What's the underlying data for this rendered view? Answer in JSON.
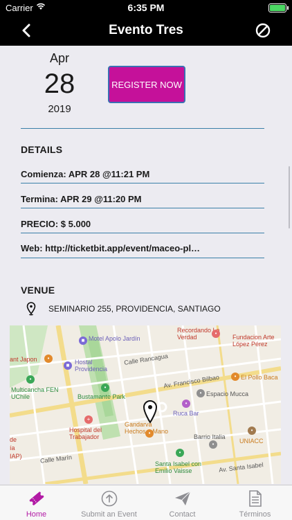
{
  "status_bar": {
    "carrier": "Carrier",
    "time": "6:35 PM"
  },
  "nav": {
    "title": "Evento Tres",
    "back_icon": "chevron-left-icon",
    "action_icon": "block-icon"
  },
  "event_date": {
    "month": "Apr",
    "day": "28",
    "year": "2019"
  },
  "register_label": "REGISTER NOW",
  "details": {
    "title": "DETAILS",
    "start": "Comienza: APR 28 @11:21 PM",
    "end": "Termina: APR 29 @11:20 PM",
    "price": "PRECIO: $ 5.000",
    "web": "Web: http://ticketbit.app/event/maceo-pl…"
  },
  "venue": {
    "title": "VENUE",
    "address": "SEMINARIO 255, PROVIDENCIA, SANTIAGO"
  },
  "map": {
    "labels": {
      "motel_apolo": "Motel Apolo Jardín",
      "hostal": "Hostal Providencia",
      "recordando": "Recordando La Verdad",
      "fundacion": "Fundacion Arte López Pérez",
      "japon": "ant Japon",
      "multicancha": "Multicancha FEN UChile",
      "calle_rancagua": "Calle Rancagua",
      "bustamante": "Bustamante Park",
      "bilbao": "Av. Francisco Bilbao",
      "pollo": "El Pollo Baca",
      "mucca": "Espacio Mucca",
      "ruca": "Ruca Bar",
      "hospital": "Hospital del Trabajador",
      "gandarva": "Gandarva Hechos a Mano",
      "barrio": "Barrio Italia",
      "uniacc": "UNIACC",
      "marin": "Calle Marín",
      "santa_isabel_av": "Av. Santa Isabel",
      "santa_isabel_con": "Santa Isabel con Emilio Vaisse",
      "edge_de": "de",
      "edge_ia": "ía",
      "edge_iap": "IAP)"
    }
  },
  "tabs": [
    {
      "label": "Home",
      "icon": "ticket-icon",
      "active": true
    },
    {
      "label": "Submit an Event",
      "icon": "upload-icon",
      "active": false
    },
    {
      "label": "Contact",
      "icon": "paper-plane-icon",
      "active": false
    },
    {
      "label": "Términos",
      "icon": "document-icon",
      "active": false
    }
  ],
  "colors": {
    "accent": "#c5119a",
    "divider": "#3a7fa8",
    "tab_active": "#b21aa5"
  }
}
